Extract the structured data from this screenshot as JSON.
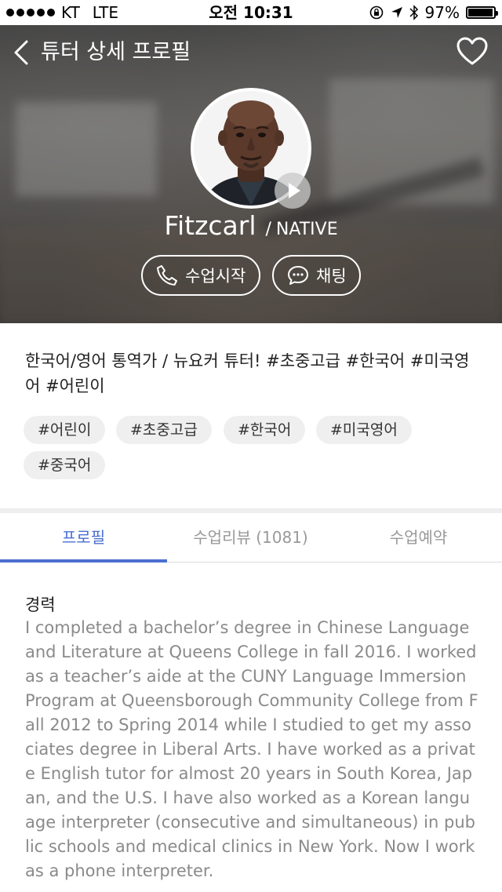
{
  "status_bar": {
    "carrier": "KT",
    "network": "LTE",
    "time": "오전 10:31",
    "battery": "97%",
    "battery_level": 0.97
  },
  "nav": {
    "title": "튜터 상세 프로필",
    "back_icon": "chevron-left-icon",
    "favorite_icon": "heart-outline-icon"
  },
  "tutor": {
    "name": "Fitzcarl",
    "separator": "/",
    "type": "NATIVE"
  },
  "actions": {
    "start_class": "수업시작",
    "chat": "채팅"
  },
  "intro": {
    "headline": "한국어/영어 통역가 / 뉴요커 튜터! #초중고급 #한국어 #미국영어 #어린이",
    "tags": [
      "#어린이",
      "#초중고급",
      "#한국어",
      "#미국영어",
      "#중국어"
    ]
  },
  "tabs": [
    {
      "label": "프로필",
      "active": true
    },
    {
      "label": "수업리뷰 (1081)",
      "active": false
    },
    {
      "label": "수업예약",
      "active": false
    }
  ],
  "career": {
    "title": "경력",
    "body": "I completed a bachelor’s degree in Chinese Language and Literature at Queens College in fall 2016. I worked as a teacher’s aide at the CUNY Language Immersion Program at Queensborough Community College from Fall 2012 to Spring 2014 while I studied to get my associates degree in Liberal Arts. I have worked as a private English tutor for almost 20 years in South Korea, Japan, and the U.S. I have also worked as a Korean language interpreter (consecutive and simultaneous) in public schools and medical clinics in New York. Now I work as a phone interpreter."
  },
  "colors": {
    "accent": "#4a6fd1",
    "tag_bg": "#efefef",
    "body_text": "#8a8a8a"
  }
}
